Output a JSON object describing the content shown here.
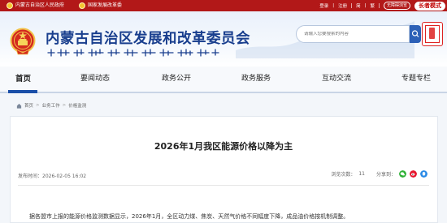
{
  "topbar": {
    "gov_link": "内蒙古自治区人民政府",
    "state_link": "国家发展改革委",
    "login": "登录",
    "register": "注册",
    "simplified": "简",
    "traditional": "繁",
    "accessibility": "无障碍浏览",
    "elder_mode": "长者模式"
  },
  "header": {
    "site_title": "内蒙古自治区发展和改革委员会",
    "search_placeholder": "请输入您要搜索的内容"
  },
  "nav": {
    "items": [
      {
        "label": "首页",
        "active": true
      },
      {
        "label": "要闻动态",
        "active": false
      },
      {
        "label": "政务公开",
        "active": false
      },
      {
        "label": "政务服务",
        "active": false
      },
      {
        "label": "互动交流",
        "active": false
      },
      {
        "label": "专题专栏",
        "active": false
      }
    ]
  },
  "breadcrumb": {
    "items": [
      "首页",
      "业务工作",
      "价格监测"
    ]
  },
  "article": {
    "title": "2026年1月我区能源价格以降为主",
    "publish_label": "发布时间：",
    "publish_time": "2026-02-05 16:02",
    "views_label": "浏览次数：",
    "views": "11",
    "share_label": "分享到：",
    "body_first_line": "据各盟市上报的能源价格监测数据显示，2026年1月，全区动力煤、焦炭、天然气价格不同幅度下降，成品油价格按机制调整。"
  },
  "colors": {
    "topbar_red": "#b21818",
    "title_blue": "#1a3f8e",
    "nav_active": "#1a4fa8",
    "share_wechat": "#2eb136",
    "share_weibo": "#e6162d",
    "share_qq": "#2a8ae6"
  },
  "icons": [
    "national-emblem-icon",
    "search-icon",
    "home-icon",
    "wechat-icon",
    "weibo-icon",
    "qq-icon"
  ]
}
